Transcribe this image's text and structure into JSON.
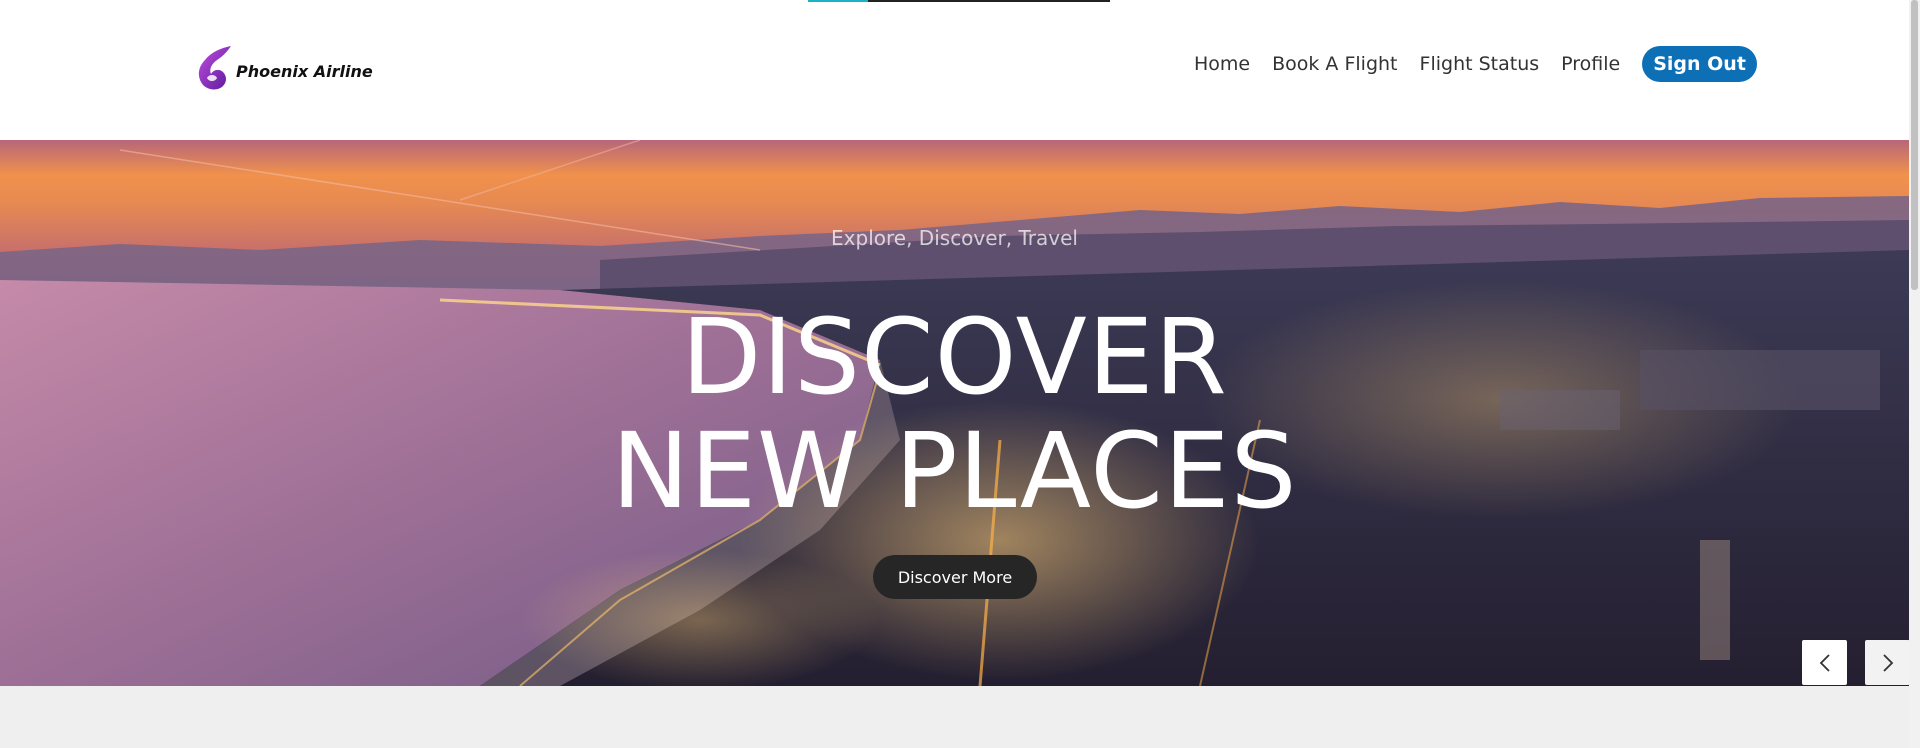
{
  "brand": {
    "name": "Phoenix Airline",
    "logo_icon": "phoenix-logo-icon",
    "accent_color": "#0d6fb5"
  },
  "nav": {
    "items": [
      {
        "label": "Home"
      },
      {
        "label": "Book A Flight"
      },
      {
        "label": "Flight Status"
      },
      {
        "label": "Profile"
      }
    ],
    "signout_label": "Sign Out"
  },
  "hero": {
    "subtitle": "Explore, Discover, Travel",
    "title_line1": "DISCOVER",
    "title_line2": "NEW PLACES",
    "button_label": "Discover More",
    "prev_icon": "chevron-left-icon",
    "next_icon": "chevron-right-icon"
  }
}
